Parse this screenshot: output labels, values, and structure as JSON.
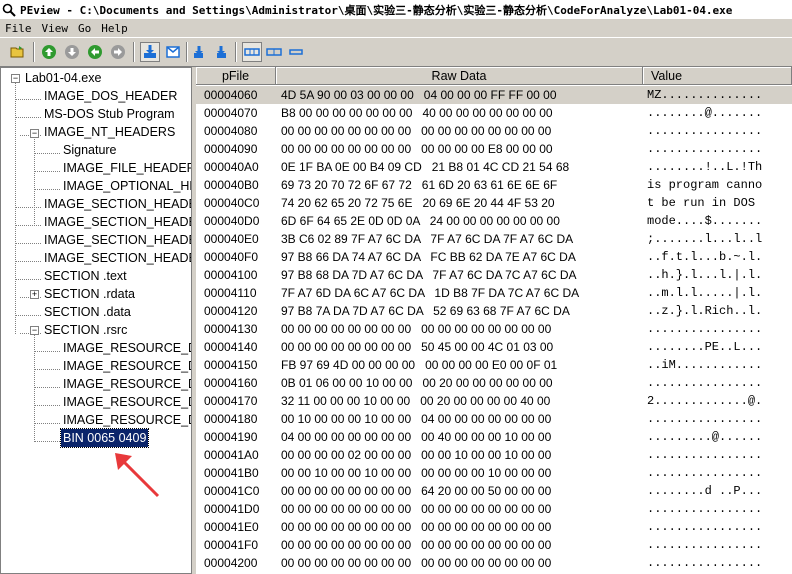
{
  "window": {
    "title": "PEview - C:\\Documents and Settings\\Administrator\\桌面\\实验三-静态分析\\实验三-静态分析\\CodeForAnalyze\\Lab01-04.exe"
  },
  "menu": [
    "File",
    "View",
    "Go",
    "Help"
  ],
  "tree": {
    "root": "Lab01-04.exe",
    "items": [
      "IMAGE_DOS_HEADER",
      "MS-DOS Stub Program",
      "IMAGE_NT_HEADERS",
      "Signature",
      "IMAGE_FILE_HEADER",
      "IMAGE_OPTIONAL_HEADER",
      "IMAGE_SECTION_HEADER .text",
      "IMAGE_SECTION_HEADER .rdata",
      "IMAGE_SECTION_HEADER .data",
      "IMAGE_SECTION_HEADER .rsrc",
      "SECTION .text",
      "SECTION .rdata",
      "SECTION .data",
      "SECTION .rsrc",
      "IMAGE_RESOURCE_DIRECTORY",
      "IMAGE_RESOURCE_DIRECTORY",
      "IMAGE_RESOURCE_DIRECTORY",
      "IMAGE_RESOURCE_DIRECTORY",
      "IMAGE_RESOURCE_DATA_ENTRY",
      "BIN 0065 0409"
    ]
  },
  "columns": [
    "pFile",
    "Raw Data",
    "Value"
  ],
  "rows": [
    {
      "off": "00004060",
      "hex": "4D 5A 90 00 03 00 00 00   04 00 00 00 FF FF 00 00",
      "val": "MZ.............."
    },
    {
      "off": "00004070",
      "hex": "B8 00 00 00 00 00 00 00   40 00 00 00 00 00 00 00",
      "val": "........@......."
    },
    {
      "off": "00004080",
      "hex": "00 00 00 00 00 00 00 00   00 00 00 00 00 00 00 00",
      "val": "................"
    },
    {
      "off": "00004090",
      "hex": "00 00 00 00 00 00 00 00   00 00 00 00 E8 00 00 00",
      "val": "................"
    },
    {
      "off": "000040A0",
      "hex": "0E 1F BA 0E 00 B4 09 CD   21 B8 01 4C CD 21 54 68",
      "val": "........!..L.!Th"
    },
    {
      "off": "000040B0",
      "hex": "69 73 20 70 72 6F 67 72   61 6D 20 63 61 6E 6E 6F",
      "val": "is program canno"
    },
    {
      "off": "000040C0",
      "hex": "74 20 62 65 20 72 75 6E   20 69 6E 20 44 4F 53 20",
      "val": "t be run in DOS "
    },
    {
      "off": "000040D0",
      "hex": "6D 6F 64 65 2E 0D 0D 0A   24 00 00 00 00 00 00 00",
      "val": "mode....$......."
    },
    {
      "off": "000040E0",
      "hex": "3B C6 02 89 7F A7 6C DA   7F A7 6C DA 7F A7 6C DA",
      "val": ";.......l...l..l"
    },
    {
      "off": "000040F0",
      "hex": "97 B8 66 DA 74 A7 6C DA   FC BB 62 DA 7E A7 6C DA",
      "val": "..f.t.l...b.~.l."
    },
    {
      "off": "00004100",
      "hex": "97 B8 68 DA 7D A7 6C DA   7F A7 6C DA 7C A7 6C DA",
      "val": "..h.}.l...l.|.l."
    },
    {
      "off": "00004110",
      "hex": "7F A7 6D DA 6C A7 6C DA   1D B8 7F DA 7C A7 6C DA",
      "val": "..m.l.l.....|.l."
    },
    {
      "off": "00004120",
      "hex": "97 B8 7A DA 7D A7 6C DA   52 69 63 68 7F A7 6C DA",
      "val": "..z.}.l.Rich..l."
    },
    {
      "off": "00004130",
      "hex": "00 00 00 00 00 00 00 00   00 00 00 00 00 00 00 00",
      "val": "................"
    },
    {
      "off": "00004140",
      "hex": "00 00 00 00 00 00 00 00   50 45 00 00 4C 01 03 00",
      "val": "........PE..L..."
    },
    {
      "off": "00004150",
      "hex": "FB 97 69 4D 00 00 00 00   00 00 00 00 E0 00 0F 01",
      "val": "..iM............"
    },
    {
      "off": "00004160",
      "hex": "0B 01 06 00 00 10 00 00   00 20 00 00 00 00 00 00",
      "val": "................"
    },
    {
      "off": "00004170",
      "hex": "32 11 00 00 00 10 00 00   00 20 00 00 00 00 40 00",
      "val": "2.............@."
    },
    {
      "off": "00004180",
      "hex": "00 10 00 00 00 10 00 00   04 00 00 00 00 00 00 00",
      "val": "................"
    },
    {
      "off": "00004190",
      "hex": "04 00 00 00 00 00 00 00   00 40 00 00 00 10 00 00",
      "val": ".........@......"
    },
    {
      "off": "000041A0",
      "hex": "00 00 00 00 02 00 00 00   00 00 10 00 00 10 00 00",
      "val": "................"
    },
    {
      "off": "000041B0",
      "hex": "00 00 10 00 00 10 00 00   00 00 00 00 10 00 00 00",
      "val": "................"
    },
    {
      "off": "000041C0",
      "hex": "00 00 00 00 00 00 00 00   64 20 00 00 50 00 00 00",
      "val": "........d ..P..."
    },
    {
      "off": "000041D0",
      "hex": "00 00 00 00 00 00 00 00   00 00 00 00 00 00 00 00",
      "val": "................"
    },
    {
      "off": "000041E0",
      "hex": "00 00 00 00 00 00 00 00   00 00 00 00 00 00 00 00",
      "val": "................"
    },
    {
      "off": "000041F0",
      "hex": "00 00 00 00 00 00 00 00   00 00 00 00 00 00 00 00",
      "val": "................"
    },
    {
      "off": "00004200",
      "hex": "00 00 00 00 00 00 00 00   00 00 00 00 00 00 00 00",
      "val": "................"
    }
  ],
  "colors": {
    "selection": "#0a246a",
    "annotation_arrow": "#e8393b",
    "toolbar_blue": "#1c6fd6",
    "toolbar_green": "#2f9a2f"
  }
}
